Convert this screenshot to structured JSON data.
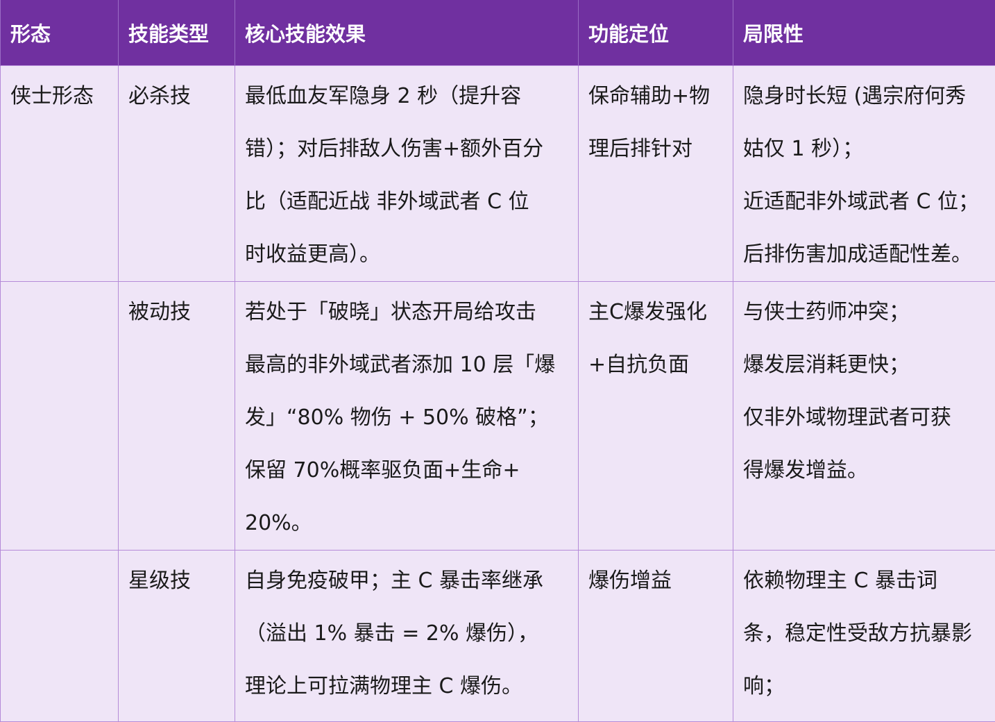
{
  "table": {
    "headers": [
      "形态",
      "技能类型",
      "核心技能效果",
      "功能定位",
      "局限性"
    ],
    "rows": [
      {
        "form": "侠士形态",
        "skill_type": "必杀技",
        "effect_lines": [
          "最低血友军隐身 2 秒（提升容",
          "错）；对后排敌人伤害+额外百分",
          "比（适配近战 非外域武者 C 位",
          "时收益更高）。"
        ],
        "role_lines": [
          "保命辅助+物",
          "理后排针对"
        ],
        "limit_lines": [
          "隐身时长短 (遇宗府何秀",
          "姑仅 1 秒）；",
          "近适配非外域武者 C 位；",
          "后排伤害加成适配性差。"
        ]
      },
      {
        "form": "",
        "skill_type": "被动技",
        "effect_lines": [
          "若处于「破晓」状态开局给攻击",
          "最高的非外域武者添加 10 层「爆",
          "发」“80% 物伤 + 50% 破格”；",
          "保留 70%概率驱负面+生命+",
          "20%。"
        ],
        "role_lines": [
          "主C爆发强化",
          "+自抗负面"
        ],
        "limit_lines": [
          "与侠士药师冲突；",
          "爆发层消耗更快；",
          "仅非外域物理武者可获",
          "得爆发增益。"
        ]
      },
      {
        "form": "",
        "skill_type": "星级技",
        "effect_lines": [
          "自身免疫破甲；主 C 暴击率继承",
          "（溢出 1% 暴击 = 2% 爆伤），",
          "理论上可拉满物理主 C 爆伤。"
        ],
        "role_lines": [
          "爆伤增益"
        ],
        "limit_lines": [
          "依赖物理主 C 暴击词",
          "条，稳定性受敌方抗暴影",
          "响；"
        ]
      }
    ]
  }
}
